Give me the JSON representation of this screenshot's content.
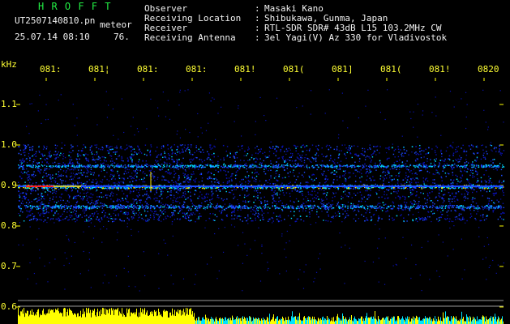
{
  "header": {
    "brand": "H R O F F T",
    "filename": "UT2507140810.pn",
    "meteor_label": "meteor",
    "date_time": "25.07.14 08:10",
    "count": "76.",
    "fields": [
      {
        "label": "Observer",
        "value": "Masaki Kano"
      },
      {
        "label": "Receiving Location",
        "value": "Shibukawa, Gunma, Japan"
      },
      {
        "label": "Receiver",
        "value": "RTL-SDR SDR# 43dB L15 103.2MHz CW"
      },
      {
        "label": "Receiving Antenna",
        "value": "3el Yagi(V) Az 330 for Vladivostok"
      }
    ],
    "colon": ":"
  },
  "spectrogram": {
    "y_unit": "kHz",
    "y_ticks": [
      "1.1",
      "1.0",
      "0.9",
      "0.8",
      "0.7",
      "0.6"
    ],
    "x_ticks": [
      "081:",
      "081¦",
      "081:",
      "081:",
      "081!",
      "081(",
      "081]",
      "081(",
      "081!",
      "0820"
    ],
    "colors": {
      "background": "#000000",
      "noise_low": "#0a12b4",
      "noise_mid": "#1e4cff",
      "signal": "#00d8ff",
      "hot": "#ffee00",
      "peak": "#ff2020",
      "level_yellow": "#ffff00",
      "level_cyan": "#00e5ff",
      "baseline": "#9a9a9a"
    }
  }
}
